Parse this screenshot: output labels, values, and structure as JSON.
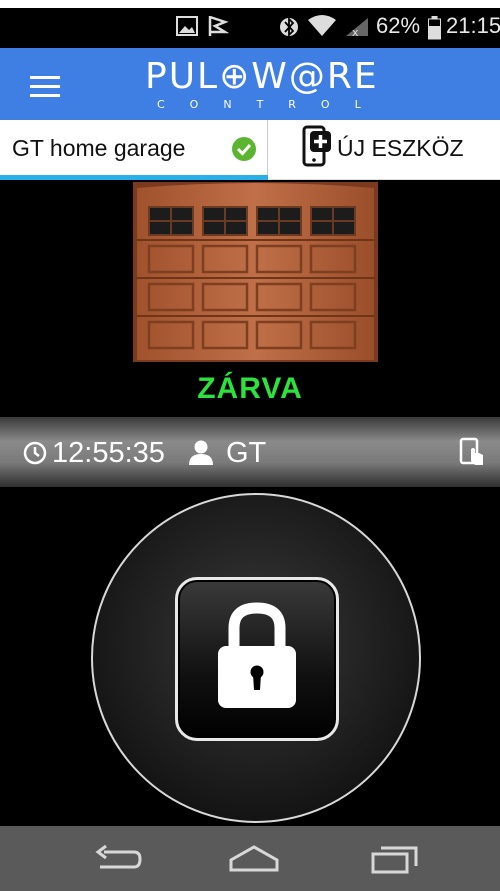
{
  "status_bar": {
    "battery": "62%",
    "time": "21:15"
  },
  "app_bar": {
    "logo_main": "PUL⊕W@RE",
    "logo_sub": "CONTROL"
  },
  "device_bar": {
    "device_name": "GT home garage",
    "add_device_label": "ÚJ ESZKÖZ"
  },
  "door": {
    "status": "ZÁRVA",
    "status_color": "#2ce23c"
  },
  "info_bar": {
    "time": "12:55:35",
    "user": "GT"
  },
  "colors": {
    "app_bar": "#3f7fe4",
    "tab_underline": "#28b0e8",
    "check": "#5cb531"
  }
}
